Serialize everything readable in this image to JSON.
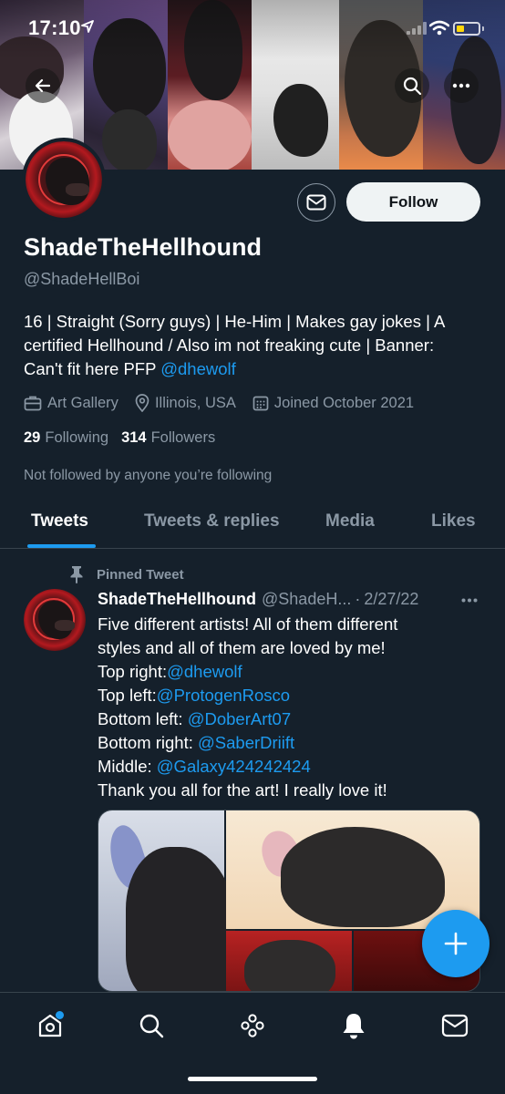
{
  "status_bar": {
    "time": "17:10"
  },
  "profile": {
    "display_name": "ShadeTheHellhound",
    "handle": "@ShadeHellBoi",
    "bio_line1": "16 | Straight (Sorry guys) | He-Him | Makes gay jokes | A",
    "bio_line2": "certified Hellhound / Also im not freaking cute | Banner:",
    "bio_line3_text": "Can't fit here PFP ",
    "bio_line3_link": "@dhewolf",
    "category": "Art Gallery",
    "location": "Illinois, USA",
    "joined": "Joined October 2021",
    "following_count": "29",
    "following_label": "Following",
    "followers_count": "314",
    "followers_label": "Followers",
    "not_followed_text": "Not followed by anyone you’re following"
  },
  "actions": {
    "follow_label": "Follow"
  },
  "tabs": [
    {
      "label": "Tweets",
      "active": true
    },
    {
      "label": "Tweets & replies",
      "active": false
    },
    {
      "label": "Media",
      "active": false
    },
    {
      "label": "Likes",
      "active": false
    }
  ],
  "pinned_tweet": {
    "pinned_label": "Pinned Tweet",
    "author_name": "ShadeTheHellhound",
    "author_handle": "@ShadeH...",
    "date": "2/27/22",
    "lines": [
      {
        "text": "Five different artists! All of them different",
        "link": ""
      },
      {
        "text": "styles and all of them are loved by me!",
        "link": ""
      },
      {
        "text": "Top right:",
        "link": "@dhewolf"
      },
      {
        "text": "Top left:",
        "link": "@ProtogenRosco"
      },
      {
        "text": "Bottom left: ",
        "link": "@DoberArt07"
      },
      {
        "text": "Bottom right: ",
        "link": "@SaberDriift"
      },
      {
        "text": "Middle: ",
        "link": "@Galaxy424242424"
      },
      {
        "text": "Thank you all for the art! I really love it!",
        "link": ""
      }
    ]
  },
  "colors": {
    "background": "#15202b",
    "accent": "#1d9bf0",
    "secondary_text": "#8b98a5",
    "divider": "#38444d"
  },
  "icons": {
    "back": "arrow-left-icon",
    "search": "search-icon",
    "more": "more-horizontal-icon",
    "mail": "mail-icon",
    "category": "briefcase-icon",
    "location": "location-pin-icon",
    "joined": "calendar-icon",
    "pin": "pin-icon",
    "compose": "plus-icon",
    "nav": [
      "home-icon",
      "search-icon",
      "spaces-icon",
      "notifications-icon",
      "messages-icon"
    ]
  },
  "battery_level": 0.35
}
